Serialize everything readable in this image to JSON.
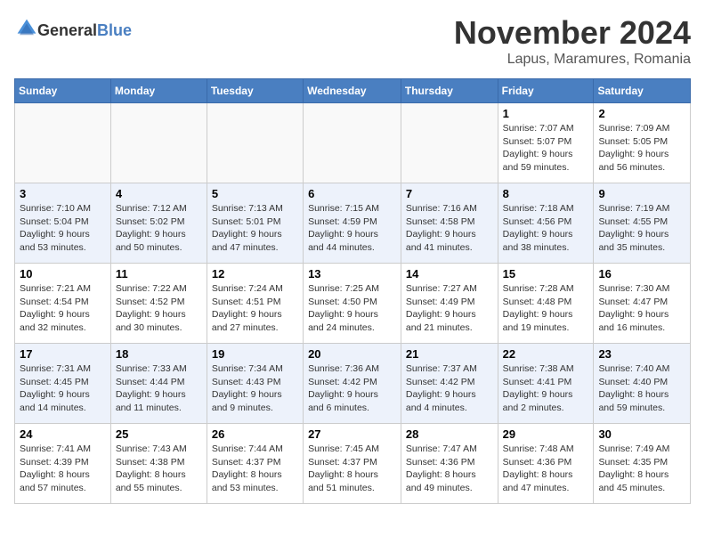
{
  "logo": {
    "text_general": "General",
    "text_blue": "Blue"
  },
  "title": "November 2024",
  "subtitle": "Lapus, Maramures, Romania",
  "days_of_week": [
    "Sunday",
    "Monday",
    "Tuesday",
    "Wednesday",
    "Thursday",
    "Friday",
    "Saturday"
  ],
  "weeks": [
    [
      {
        "day": "",
        "detail": ""
      },
      {
        "day": "",
        "detail": ""
      },
      {
        "day": "",
        "detail": ""
      },
      {
        "day": "",
        "detail": ""
      },
      {
        "day": "",
        "detail": ""
      },
      {
        "day": "1",
        "detail": "Sunrise: 7:07 AM\nSunset: 5:07 PM\nDaylight: 9 hours and 59 minutes."
      },
      {
        "day": "2",
        "detail": "Sunrise: 7:09 AM\nSunset: 5:05 PM\nDaylight: 9 hours and 56 minutes."
      }
    ],
    [
      {
        "day": "3",
        "detail": "Sunrise: 7:10 AM\nSunset: 5:04 PM\nDaylight: 9 hours and 53 minutes."
      },
      {
        "day": "4",
        "detail": "Sunrise: 7:12 AM\nSunset: 5:02 PM\nDaylight: 9 hours and 50 minutes."
      },
      {
        "day": "5",
        "detail": "Sunrise: 7:13 AM\nSunset: 5:01 PM\nDaylight: 9 hours and 47 minutes."
      },
      {
        "day": "6",
        "detail": "Sunrise: 7:15 AM\nSunset: 4:59 PM\nDaylight: 9 hours and 44 minutes."
      },
      {
        "day": "7",
        "detail": "Sunrise: 7:16 AM\nSunset: 4:58 PM\nDaylight: 9 hours and 41 minutes."
      },
      {
        "day": "8",
        "detail": "Sunrise: 7:18 AM\nSunset: 4:56 PM\nDaylight: 9 hours and 38 minutes."
      },
      {
        "day": "9",
        "detail": "Sunrise: 7:19 AM\nSunset: 4:55 PM\nDaylight: 9 hours and 35 minutes."
      }
    ],
    [
      {
        "day": "10",
        "detail": "Sunrise: 7:21 AM\nSunset: 4:54 PM\nDaylight: 9 hours and 32 minutes."
      },
      {
        "day": "11",
        "detail": "Sunrise: 7:22 AM\nSunset: 4:52 PM\nDaylight: 9 hours and 30 minutes."
      },
      {
        "day": "12",
        "detail": "Sunrise: 7:24 AM\nSunset: 4:51 PM\nDaylight: 9 hours and 27 minutes."
      },
      {
        "day": "13",
        "detail": "Sunrise: 7:25 AM\nSunset: 4:50 PM\nDaylight: 9 hours and 24 minutes."
      },
      {
        "day": "14",
        "detail": "Sunrise: 7:27 AM\nSunset: 4:49 PM\nDaylight: 9 hours and 21 minutes."
      },
      {
        "day": "15",
        "detail": "Sunrise: 7:28 AM\nSunset: 4:48 PM\nDaylight: 9 hours and 19 minutes."
      },
      {
        "day": "16",
        "detail": "Sunrise: 7:30 AM\nSunset: 4:47 PM\nDaylight: 9 hours and 16 minutes."
      }
    ],
    [
      {
        "day": "17",
        "detail": "Sunrise: 7:31 AM\nSunset: 4:45 PM\nDaylight: 9 hours and 14 minutes."
      },
      {
        "day": "18",
        "detail": "Sunrise: 7:33 AM\nSunset: 4:44 PM\nDaylight: 9 hours and 11 minutes."
      },
      {
        "day": "19",
        "detail": "Sunrise: 7:34 AM\nSunset: 4:43 PM\nDaylight: 9 hours and 9 minutes."
      },
      {
        "day": "20",
        "detail": "Sunrise: 7:36 AM\nSunset: 4:42 PM\nDaylight: 9 hours and 6 minutes."
      },
      {
        "day": "21",
        "detail": "Sunrise: 7:37 AM\nSunset: 4:42 PM\nDaylight: 9 hours and 4 minutes."
      },
      {
        "day": "22",
        "detail": "Sunrise: 7:38 AM\nSunset: 4:41 PM\nDaylight: 9 hours and 2 minutes."
      },
      {
        "day": "23",
        "detail": "Sunrise: 7:40 AM\nSunset: 4:40 PM\nDaylight: 8 hours and 59 minutes."
      }
    ],
    [
      {
        "day": "24",
        "detail": "Sunrise: 7:41 AM\nSunset: 4:39 PM\nDaylight: 8 hours and 57 minutes."
      },
      {
        "day": "25",
        "detail": "Sunrise: 7:43 AM\nSunset: 4:38 PM\nDaylight: 8 hours and 55 minutes."
      },
      {
        "day": "26",
        "detail": "Sunrise: 7:44 AM\nSunset: 4:37 PM\nDaylight: 8 hours and 53 minutes."
      },
      {
        "day": "27",
        "detail": "Sunrise: 7:45 AM\nSunset: 4:37 PM\nDaylight: 8 hours and 51 minutes."
      },
      {
        "day": "28",
        "detail": "Sunrise: 7:47 AM\nSunset: 4:36 PM\nDaylight: 8 hours and 49 minutes."
      },
      {
        "day": "29",
        "detail": "Sunrise: 7:48 AM\nSunset: 4:36 PM\nDaylight: 8 hours and 47 minutes."
      },
      {
        "day": "30",
        "detail": "Sunrise: 7:49 AM\nSunset: 4:35 PM\nDaylight: 8 hours and 45 minutes."
      }
    ]
  ]
}
